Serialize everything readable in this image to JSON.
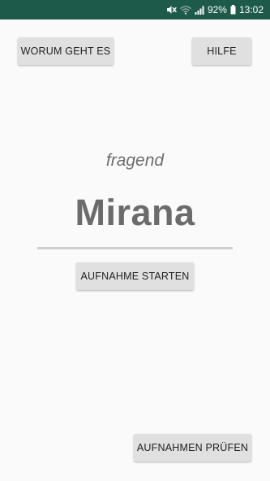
{
  "status_bar": {
    "battery_percent": "92%",
    "time": "13:02",
    "icons": [
      "mute-icon",
      "wifi-icon",
      "signal-icon",
      "battery-icon"
    ],
    "background_color": "#1e5a4a"
  },
  "buttons": {
    "about": "WORUM GEHT ES",
    "help": "HILFE",
    "record": "AUFNAHME STARTEN",
    "check": "AUFNAHMEN PRÜFEN"
  },
  "main": {
    "mood": "fragend",
    "word": "Mirana"
  }
}
